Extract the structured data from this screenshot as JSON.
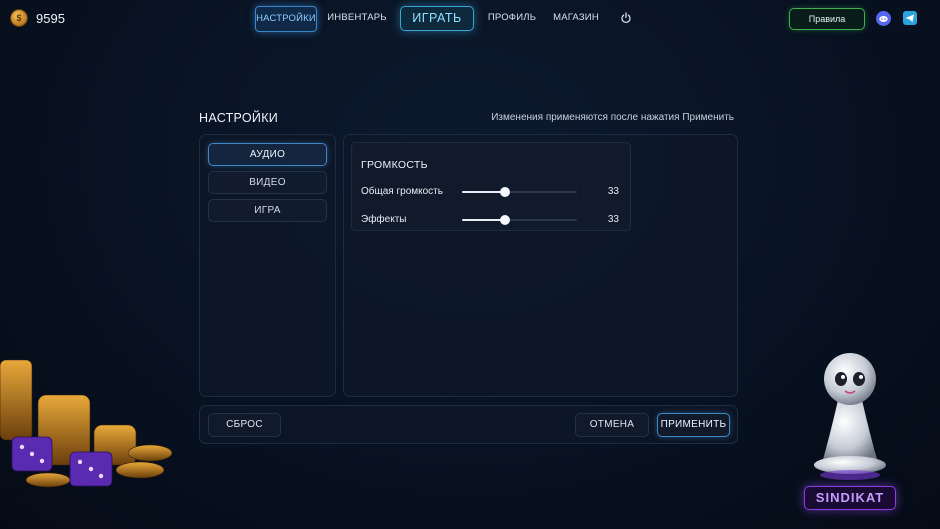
{
  "header": {
    "coins": "9595",
    "nav": {
      "settings": "НАСТРОЙКИ",
      "inventory": "ИНВЕНТАРЬ",
      "play": "ИГРАТЬ",
      "profile": "ПРОФИЛЬ",
      "shop": "МАГАЗИН"
    },
    "rules": "Правила"
  },
  "settings": {
    "title": "НАСТРОЙКИ",
    "hint": "Изменения применяются после нажатия Применить",
    "categories": [
      "АУДИО",
      "ВИДЕО",
      "ИГРА"
    ],
    "active_category": "АУДИО",
    "volume": {
      "title": "ГРОМКОСТЬ",
      "rows": [
        {
          "label": "Общая громкость",
          "value": "33",
          "level": 0.37
        },
        {
          "label": "Эффекты",
          "value": "33",
          "level": 0.37
        }
      ]
    },
    "buttons": {
      "reset": "СБРОС",
      "cancel": "ОТМЕНА",
      "apply": "ПРИМЕНИТЬ"
    }
  },
  "brand": "SINDIKAT",
  "colors": {
    "accent_blue": "#3a86c8",
    "play_cyan": "#39a7d6",
    "rules_green": "#3fb24a",
    "brand_purple": "#8a3fe0"
  }
}
